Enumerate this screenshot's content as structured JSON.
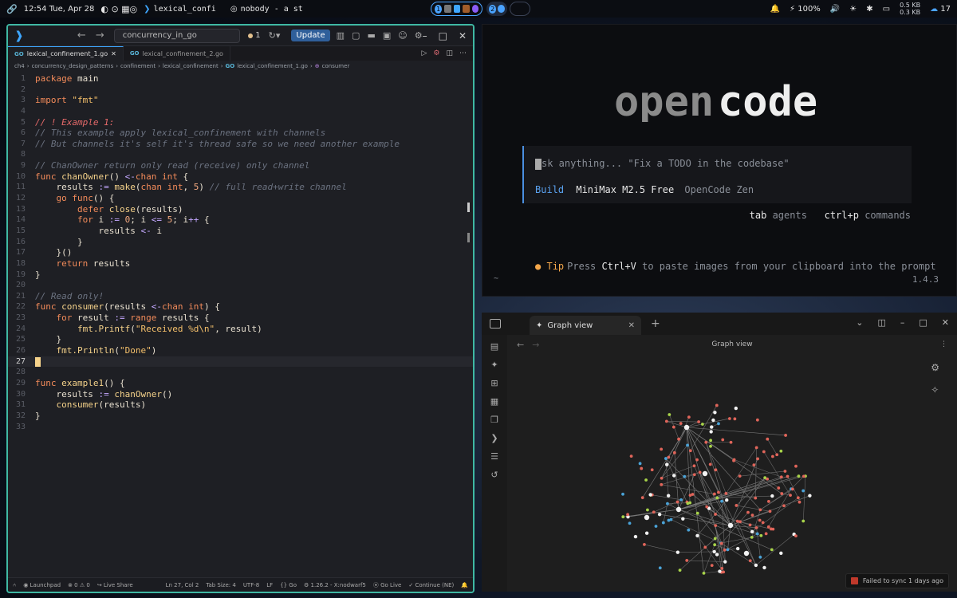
{
  "topbar": {
    "datetime": "12:54 Tue, Apr 28",
    "vscode_window": "lexical_confi",
    "music": "nobody - a st",
    "workspace1": "1",
    "workspace2": "2",
    "battery": "100%",
    "net_up": "0.5 KB",
    "net_down": "0.3 KB",
    "temp": "17"
  },
  "vscode": {
    "search": "concurrency_in_go",
    "badge_count": "1",
    "update_label": "Update",
    "tabs": [
      {
        "label": "lexical_confinement_1.go",
        "active": true
      },
      {
        "label": "lexical_confinement_2.go",
        "active": false
      }
    ],
    "breadcrumb": [
      "ch4",
      "concurrency_design_patterns",
      "confinement",
      "lexical_confinement",
      "lexical_confinement_1.go",
      "consumer"
    ],
    "status": {
      "launchpad": "Launchpad",
      "problems": "0 ⚠ 0",
      "liveshare": "Live Share",
      "position": "Ln 27, Col 2",
      "tabsize": "Tab Size: 4",
      "encoding": "UTF-8",
      "eol": "LF",
      "lang": "{} Go",
      "version": "1.26.2 - X:nodwarf5",
      "golive": "Go Live",
      "continue": "Continue (NE)"
    },
    "code": [
      [
        [
          "kw",
          "package"
        ],
        [
          "id",
          " main"
        ]
      ],
      [],
      [
        [
          "kw",
          "import"
        ],
        [
          "id",
          " "
        ],
        [
          "str",
          "\"fmt\""
        ]
      ],
      [],
      [
        [
          "cm-red",
          "// ! Example 1:"
        ]
      ],
      [
        [
          "cm",
          "// This example apply lexical_confinement with channels"
        ]
      ],
      [
        [
          "cm",
          "// But channels it's self it's thread safe so we need another example"
        ]
      ],
      [],
      [
        [
          "cm",
          "// ChanOwner return only read (receive) only channel"
        ]
      ],
      [
        [
          "kw",
          "func"
        ],
        [
          "fn",
          " chanOwner"
        ],
        [
          "id",
          "() "
        ],
        [
          "op",
          "<-"
        ],
        [
          "kw",
          "chan"
        ],
        [
          "typ",
          " int"
        ],
        [
          "id",
          " {"
        ]
      ],
      [
        [
          "id",
          "    results "
        ],
        [
          "op",
          ":="
        ],
        [
          "fn",
          " make"
        ],
        [
          "id",
          "("
        ],
        [
          "kw",
          "chan"
        ],
        [
          "typ",
          " int"
        ],
        [
          "id",
          ", "
        ],
        [
          "num",
          "5"
        ],
        [
          "id",
          ") "
        ],
        [
          "cm",
          "// full read+write channel"
        ]
      ],
      [
        [
          "kw",
          "    go"
        ],
        [
          "kw",
          " func"
        ],
        [
          "id",
          "() {"
        ]
      ],
      [
        [
          "kw",
          "        defer"
        ],
        [
          "fn",
          " close"
        ],
        [
          "id",
          "(results)"
        ]
      ],
      [
        [
          "kw",
          "        for"
        ],
        [
          "id",
          " i "
        ],
        [
          "op",
          ":="
        ],
        [
          "num",
          " 0"
        ],
        [
          "id",
          "; i "
        ],
        [
          "op",
          "<="
        ],
        [
          "num",
          " 5"
        ],
        [
          "id",
          "; i"
        ],
        [
          "op",
          "++"
        ],
        [
          "id",
          " {"
        ]
      ],
      [
        [
          "id",
          "            results "
        ],
        [
          "op",
          "<-"
        ],
        [
          "id",
          " i"
        ]
      ],
      [
        [
          "id",
          "        }"
        ]
      ],
      [
        [
          "id",
          "    }()"
        ]
      ],
      [
        [
          "kw",
          "    return"
        ],
        [
          "id",
          " results"
        ]
      ],
      [
        [
          "id",
          "}"
        ]
      ],
      [],
      [
        [
          "cm",
          "// Read only!"
        ]
      ],
      [
        [
          "kw",
          "func"
        ],
        [
          "fn",
          " consumer"
        ],
        [
          "id",
          "(results "
        ],
        [
          "op",
          "<-"
        ],
        [
          "kw",
          "chan"
        ],
        [
          "typ",
          " int"
        ],
        [
          "id",
          ") {"
        ]
      ],
      [
        [
          "kw",
          "    for"
        ],
        [
          "id",
          " result "
        ],
        [
          "op",
          ":="
        ],
        [
          "kw",
          " range"
        ],
        [
          "id",
          " results {"
        ]
      ],
      [
        [
          "fn",
          "        fmt.Printf"
        ],
        [
          "id",
          "("
        ],
        [
          "str",
          "\"Received %d\\n\""
        ],
        [
          "id",
          ", result)"
        ]
      ],
      [
        [
          "id",
          "    }"
        ]
      ],
      [
        [
          "fn",
          "    fmt.Println"
        ],
        [
          "id",
          "("
        ],
        [
          "str",
          "\"Done\""
        ],
        [
          "id",
          ")"
        ]
      ],
      [
        [
          "cursor",
          ""
        ]
      ],
      [],
      [
        [
          "kw",
          "func"
        ],
        [
          "fn",
          " example1"
        ],
        [
          "id",
          "() {"
        ]
      ],
      [
        [
          "id",
          "    results "
        ],
        [
          "op",
          ":="
        ],
        [
          "fn",
          " chanOwner"
        ],
        [
          "id",
          "()"
        ]
      ],
      [
        [
          "fn",
          "    consumer"
        ],
        [
          "id",
          "(results)"
        ]
      ],
      [
        [
          "id",
          "}"
        ]
      ],
      []
    ]
  },
  "opencode": {
    "logo_left": "open",
    "logo_right": "code",
    "placeholder": "sk anything... \"Fix a TODO in the codebase\"",
    "mode": "Build",
    "model": "MiniMax M2.5 Free",
    "provider": "OpenCode Zen",
    "hint_tab": "tab",
    "hint_tab_desc": " agents",
    "hint_cmd": "ctrl+p",
    "hint_cmd_desc": " commands",
    "tip_label": "Tip",
    "tip_pre": "Press ",
    "tip_key": "Ctrl+V",
    "tip_post": " to paste images from your clipboard into the prompt",
    "tilde": "~",
    "version": "1.4.3"
  },
  "obsidian": {
    "tab_label": "Graph view",
    "header_title": "Graph view",
    "sync_text": "Failed to sync 1 days ago"
  },
  "colors": {
    "accent": "#3fb8a4",
    "node_red": "#e0655a",
    "node_white": "#f2f2f2",
    "node_blue": "#4aa3d8",
    "node_green": "#a8d44a"
  }
}
